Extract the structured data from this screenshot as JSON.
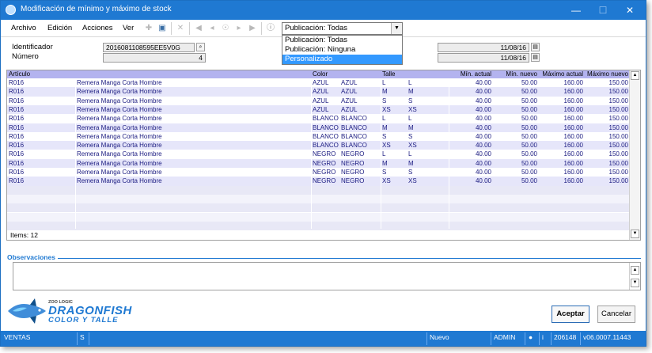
{
  "window": {
    "title": "Modificación de mínimo y máximo de stock"
  },
  "menu": {
    "items": [
      {
        "label": "Archivo",
        "accel": "A"
      },
      {
        "label": "Edición",
        "accel": "E"
      },
      {
        "label": "Acciones",
        "accel": "A"
      },
      {
        "label": "Ver",
        "accel": "V"
      }
    ]
  },
  "toolbar": {
    "publicacion_selected": "Publicación: Todas",
    "publicacion_options": [
      "Publicación: Todas",
      "Publicación: Ninguna",
      "Personalizado"
    ],
    "highlighted_option": "Personalizado"
  },
  "form": {
    "identificador_label": "Identificador",
    "identificador_value": "2016081108595EE5V0G",
    "numero_label": "Número",
    "numero_value": "4",
    "fecha1": "11/08/16",
    "fecha2": "11/08/16"
  },
  "grid": {
    "headers": [
      "Artículo",
      "Color",
      "Talle",
      "Mín. actual",
      "Mín. nuevo",
      "Máximo actual",
      "Máximo nuevo"
    ],
    "rows": [
      {
        "code": "R016",
        "desc": "Remera Manga Corta Hombre",
        "color_code": "AZUL",
        "color": "AZUL",
        "talle_code": "L",
        "talle": "L",
        "min_actual": "40.00",
        "min_nuevo": "50.00",
        "max_actual": "160.00",
        "max_nuevo": "150.00"
      },
      {
        "code": "R016",
        "desc": "Remera Manga Corta Hombre",
        "color_code": "AZUL",
        "color": "AZUL",
        "talle_code": "M",
        "talle": "M",
        "min_actual": "40.00",
        "min_nuevo": "50.00",
        "max_actual": "160.00",
        "max_nuevo": "150.00"
      },
      {
        "code": "R016",
        "desc": "Remera Manga Corta Hombre",
        "color_code": "AZUL",
        "color": "AZUL",
        "talle_code": "S",
        "talle": "S",
        "min_actual": "40.00",
        "min_nuevo": "50.00",
        "max_actual": "160.00",
        "max_nuevo": "150.00"
      },
      {
        "code": "R016",
        "desc": "Remera Manga Corta Hombre",
        "color_code": "AZUL",
        "color": "AZUL",
        "talle_code": "XS",
        "talle": "XS",
        "min_actual": "40.00",
        "min_nuevo": "50.00",
        "max_actual": "160.00",
        "max_nuevo": "150.00"
      },
      {
        "code": "R016",
        "desc": "Remera Manga Corta Hombre",
        "color_code": "BLANCO",
        "color": "BLANCO",
        "talle_code": "L",
        "talle": "L",
        "min_actual": "40.00",
        "min_nuevo": "50.00",
        "max_actual": "160.00",
        "max_nuevo": "150.00"
      },
      {
        "code": "R016",
        "desc": "Remera Manga Corta Hombre",
        "color_code": "BLANCO",
        "color": "BLANCO",
        "talle_code": "M",
        "talle": "M",
        "min_actual": "40.00",
        "min_nuevo": "50.00",
        "max_actual": "160.00",
        "max_nuevo": "150.00"
      },
      {
        "code": "R016",
        "desc": "Remera Manga Corta Hombre",
        "color_code": "BLANCO",
        "color": "BLANCO",
        "talle_code": "S",
        "talle": "S",
        "min_actual": "40.00",
        "min_nuevo": "50.00",
        "max_actual": "160.00",
        "max_nuevo": "150.00"
      },
      {
        "code": "R016",
        "desc": "Remera Manga Corta Hombre",
        "color_code": "BLANCO",
        "color": "BLANCO",
        "talle_code": "XS",
        "talle": "XS",
        "min_actual": "40.00",
        "min_nuevo": "50.00",
        "max_actual": "160.00",
        "max_nuevo": "150.00"
      },
      {
        "code": "R016",
        "desc": "Remera Manga Corta Hombre",
        "color_code": "NEGRO",
        "color": "NEGRO",
        "talle_code": "L",
        "talle": "L",
        "min_actual": "40.00",
        "min_nuevo": "50.00",
        "max_actual": "160.00",
        "max_nuevo": "150.00"
      },
      {
        "code": "R016",
        "desc": "Remera Manga Corta Hombre",
        "color_code": "NEGRO",
        "color": "NEGRO",
        "talle_code": "M",
        "talle": "M",
        "min_actual": "40.00",
        "min_nuevo": "50.00",
        "max_actual": "160.00",
        "max_nuevo": "150.00"
      },
      {
        "code": "R016",
        "desc": "Remera Manga Corta Hombre",
        "color_code": "NEGRO",
        "color": "NEGRO",
        "talle_code": "S",
        "talle": "S",
        "min_actual": "40.00",
        "min_nuevo": "50.00",
        "max_actual": "160.00",
        "max_nuevo": "150.00"
      },
      {
        "code": "R016",
        "desc": "Remera Manga Corta Hombre",
        "color_code": "NEGRO",
        "color": "NEGRO",
        "talle_code": "XS",
        "talle": "XS",
        "min_actual": "40.00",
        "min_nuevo": "50.00",
        "max_actual": "160.00",
        "max_nuevo": "150.00"
      }
    ],
    "items_label": "Items: 12"
  },
  "observaciones": {
    "label": "Observaciones"
  },
  "logo": {
    "small": "ZOO LOGIC",
    "main": "DRAGONFISH",
    "sub": "COLOR Y TALLE"
  },
  "buttons": {
    "accept": "Aceptar",
    "cancel": "Cancelar"
  },
  "status": {
    "module": "VENTAS",
    "flag": "S",
    "state": "Nuevo",
    "user": "ADMIN",
    "code": "206148",
    "version": "v06.0007.11443"
  },
  "colors": {
    "titlebar": "#1f79d2",
    "grid_header": "#b3b3ef",
    "row_alt": "#e6e6fa",
    "selection": "#3399ff"
  }
}
